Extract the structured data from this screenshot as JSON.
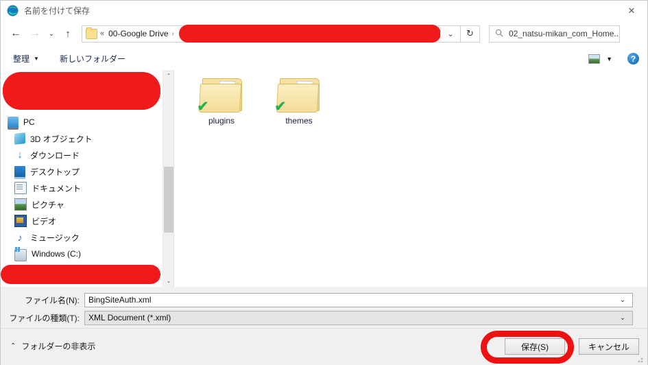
{
  "window": {
    "title": "名前を付けて保存",
    "app_icon": "edge-icon",
    "close_label": "✕"
  },
  "nav": {
    "back_icon": "←",
    "forward_icon": "→",
    "recent_icon": "⌄",
    "up_icon": "↑",
    "refresh_icon": "↻",
    "dropdown_icon": "⌄"
  },
  "address": {
    "folder_icon": "folder-icon",
    "overflow_chevrons": "«",
    "crumb": "00-Google Drive",
    "separator": "›",
    "redacted": ""
  },
  "search": {
    "icon": "search-icon",
    "text": "02_natsu-mikan_com_Home..."
  },
  "toolbar": {
    "organize_label": "整理",
    "organize_caret": "▼",
    "new_folder_label": "新しいフォルダー",
    "view_caret": "▼",
    "help_label": "?"
  },
  "sidebar": {
    "scroll_up_icon": "⌃",
    "scroll_down_icon": "⌄",
    "items": [
      {
        "label": "PC",
        "icon": "pc-icon",
        "indent": 0
      },
      {
        "label": "3D オブジェクト",
        "icon": "3d-objects-icon",
        "indent": 1
      },
      {
        "label": "ダウンロード",
        "icon": "downloads-icon",
        "indent": 1
      },
      {
        "label": "デスクトップ",
        "icon": "desktop-icon",
        "indent": 1
      },
      {
        "label": "ドキュメント",
        "icon": "documents-icon",
        "indent": 1
      },
      {
        "label": "ピクチャ",
        "icon": "pictures-icon",
        "indent": 1
      },
      {
        "label": "ビデオ",
        "icon": "videos-icon",
        "indent": 1
      },
      {
        "label": "ミュージック",
        "icon": "music-icon",
        "indent": 1
      },
      {
        "label": "Windows (C:)",
        "icon": "drive-icon",
        "indent": 1
      }
    ]
  },
  "files": [
    {
      "name": "plugins",
      "type": "folder",
      "sync_badge": "✔"
    },
    {
      "name": "themes",
      "type": "folder",
      "sync_badge": "✔"
    }
  ],
  "form": {
    "filename_label": "ファイル名(N):",
    "filename_value": "BingSiteAuth.xml",
    "filetype_label": "ファイルの種類(T):",
    "filetype_value": "XML Document (*.xml)",
    "caret": "⌄"
  },
  "footer": {
    "hide_folders_caret": "⌃",
    "hide_folders_label": "フォルダーの非表示",
    "save_label": "保存(S)",
    "cancel_label": "キャンセル"
  },
  "annotations": {
    "highlight_color": "#ee1111",
    "redaction_color": "#f01a1a"
  }
}
